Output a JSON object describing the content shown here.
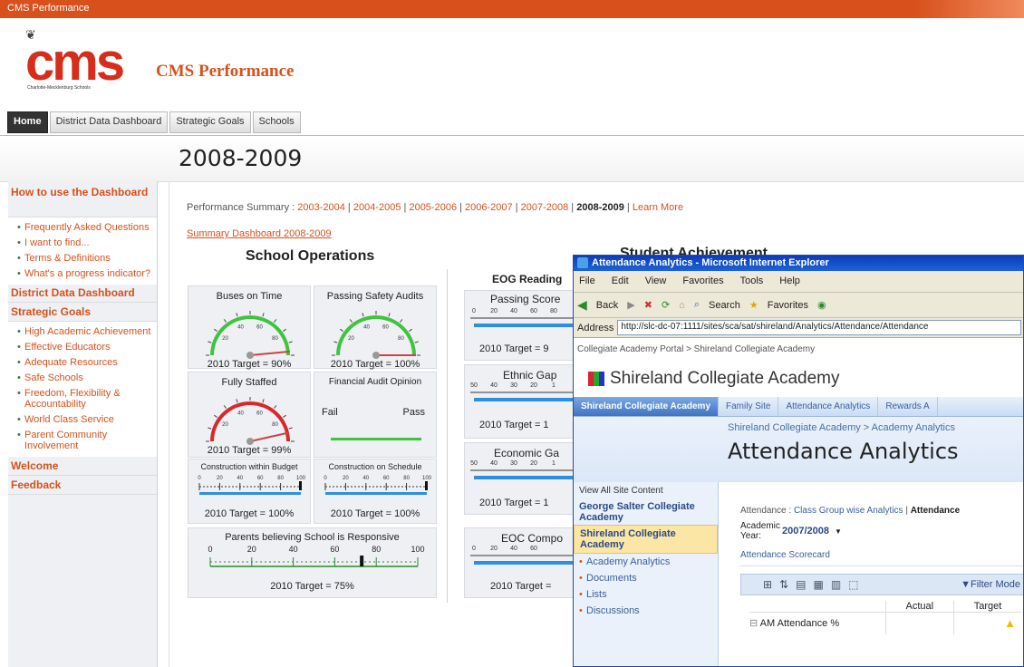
{
  "window_title": "CMS Performance",
  "logo": {
    "wordmark": "cms",
    "tagline": "Charlotte-Mecklenburg Schools"
  },
  "site_title": "CMS Performance",
  "nav_tabs": [
    "Home",
    "District Data Dashboard",
    "Strategic Goals",
    "Schools"
  ],
  "page_year": "2008-2009",
  "left_nav": {
    "how_to": "How to use the Dashboard",
    "how_to_items": [
      "Frequently Asked Questions",
      "I want to find...",
      "Terms & Definitions",
      "What's a progress indicator?"
    ],
    "district": "District Data Dashboard",
    "strategic": "Strategic Goals",
    "strategic_items": [
      "High Academic Achievement",
      "Effective Educators",
      "Adequate Resources",
      "Safe Schools",
      "Freedom, Flexibility & Accountability",
      "World Class Service",
      "Parent Community Involvement"
    ],
    "welcome": "Welcome",
    "feedback": "Feedback"
  },
  "performance_summary": {
    "label": "Performance Summary :",
    "years": [
      "2003-2004",
      "2004-2005",
      "2005-2006",
      "2006-2007",
      "2007-2008"
    ],
    "current": "2008-2009",
    "learn": "Learn More"
  },
  "summary_link": "Summary Dashboard 2008-2009",
  "school_ops": "School Operations",
  "student_ach": "Student Achievement",
  "gauges": [
    {
      "title": "Buses on Time",
      "target": "2010 Target = 90%",
      "color": "#3fc43f",
      "level": 0.97
    },
    {
      "title": "Passing Safety Audits",
      "target": "2010 Target = 100%",
      "color": "#3fc43f",
      "level": 1.0
    },
    {
      "title": "Fully Staffed",
      "target": "2010 Target = 99%",
      "color": "#d8282a",
      "level": 0.93
    }
  ],
  "gauge_ticks": [
    "20",
    "40",
    "60",
    "80"
  ],
  "audit": {
    "title": "Financial Audit Opinion",
    "fail": "Fail",
    "pass": "Pass"
  },
  "budget": {
    "title": "Construction within Budget",
    "target": "2010 Target = 100%",
    "level": 1.0
  },
  "schedule": {
    "title": "Construction on Schedule",
    "target": "2010 Target = 100%",
    "level": 1.0
  },
  "small_ticks": [
    "0",
    "20",
    "40",
    "60",
    "80",
    "100"
  ],
  "parents": {
    "title": "Parents believing School is Responsive",
    "ticks": [
      "0",
      "20",
      "40",
      "60",
      "80",
      "100"
    ],
    "target": "2010 Target = 75%",
    "level": 0.73
  },
  "eog_reading": {
    "title": "EOG Reading",
    "sub": "Passing Score",
    "ticks": [
      "0",
      "20",
      "40",
      "60",
      "80"
    ],
    "target": "2010 Target = 9"
  },
  "ethnic": {
    "title": "Ethnic Gap",
    "ticks": [
      "50",
      "40",
      "30",
      "20",
      "1"
    ],
    "target": "2010 Target = 1"
  },
  "economic": {
    "title": "Economic Ga",
    "ticks": [
      "50",
      "40",
      "30",
      "20",
      "1"
    ],
    "target": "2010 Target = 1"
  },
  "eoc": {
    "title": "EOC Compo",
    "ticks": [
      "0",
      "20",
      "40",
      "60"
    ],
    "target": "2010 Target ="
  },
  "ie": {
    "title": "Attendance Analytics - Microsoft Internet Explorer",
    "menu": [
      "File",
      "Edit",
      "View",
      "Favorites",
      "Tools",
      "Help"
    ],
    "toolbar": {
      "back": "Back",
      "search": "Search",
      "favorites": "Favorites"
    },
    "address_label": "Address",
    "url": "http://slc-dc-07:1111/sites/sca/sat/shireland/Analytics/Attendance/Attendance",
    "breadcrumb": "Collegiate Academy Portal > Shireland Collegiate Academy",
    "site_name": "Shireland Collegiate Academy",
    "tabs": [
      "Shireland Collegiate Academy",
      "Family Site",
      "Attendance Analytics",
      "Rewards A"
    ],
    "crumb2": "Shireland Collegiate Academy > Academy Analytics",
    "page_title": "Attendance Analytics",
    "quick": {
      "view_all": "View All Site Content",
      "george": "George Salter Collegiate Academy",
      "shireland": "Shireland Collegiate Academy",
      "items": [
        "Academy Analytics",
        "Documents",
        "Lists",
        "Discussions"
      ]
    },
    "attendance_line": "Attendance :",
    "class_group": "Class Group wise Analytics",
    "attendance_bold": "Attendance",
    "academic_year_label": "Academic Year:",
    "academic_year": "2007/2008",
    "scorecard": "Attendance Scorecard",
    "filter": "Filter Mode",
    "cols": [
      "Actual",
      "Target"
    ],
    "row": "AM Attendance %"
  }
}
